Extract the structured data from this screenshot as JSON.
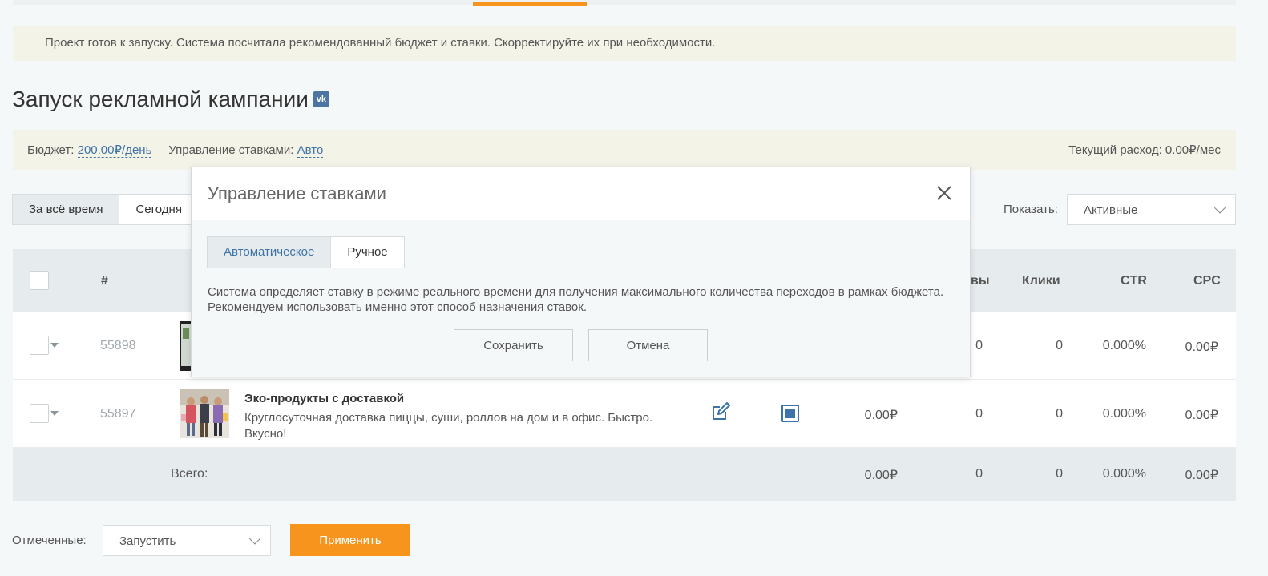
{
  "notice": "Проект готов к запуску. Система посчитала рекомендованный бюджет и ставки. Скорректируйте их при необходимости.",
  "page_title": "Запуск рекламной кампании",
  "vk_icon_text": "vk",
  "budget": {
    "label": "Бюджет:",
    "value": "200.00₽/день",
    "bid_label": "Управление ставками:",
    "bid_value": "Авто",
    "spend": "Текущий расход: 0.00₽/мес"
  },
  "period_tabs": [
    "За всё время",
    "Сегодня"
  ],
  "show": {
    "label": "Показать:",
    "value": "Активные"
  },
  "table": {
    "headers": {
      "id": "#",
      "views_partial": "вы",
      "clicks": "Клики",
      "ctr": "CTR",
      "cpc": "CPC"
    },
    "rows": [
      {
        "id": "55898",
        "views_partial": "0",
        "clicks": "0",
        "ctr": "0.000%",
        "cpc": "0.00₽"
      },
      {
        "id": "55897",
        "title": "Эко-продукты с доставкой",
        "text": "Круглосуточная доставка пиццы, суши, роллов на дом и в офис. Быстро. Вкусно!",
        "spend": "0.00₽",
        "views": "0",
        "clicks": "0",
        "ctr": "0.000%",
        "cpc": "0.00₽"
      }
    ],
    "total": {
      "label": "Всего:",
      "spend": "0.00₽",
      "views": "0",
      "clicks": "0",
      "ctr": "0.000%",
      "cpc": "0.00₽"
    }
  },
  "footer": {
    "label": "Отмеченные:",
    "action": "Запустить",
    "apply": "Применить"
  },
  "modal": {
    "title": "Управление ставками",
    "tabs": [
      "Автоматическое",
      "Ручное"
    ],
    "description": "Система определяет ставку в режиме реального времени для получения максимального количества переходов в рамках бюджета. Рекомендуем использовать именно этот способ назначения ставок.",
    "save": "Сохранить",
    "cancel": "Отмена"
  },
  "colors": {
    "accent": "#f7941d",
    "link": "#3d73a8",
    "notice_bg": "#f4f3e8",
    "header_bg": "#e6ebed"
  },
  "icons": [
    "vk-icon",
    "chevron-down-icon",
    "edit-icon",
    "stop-icon",
    "close-icon",
    "dropdown-caret-icon"
  ]
}
